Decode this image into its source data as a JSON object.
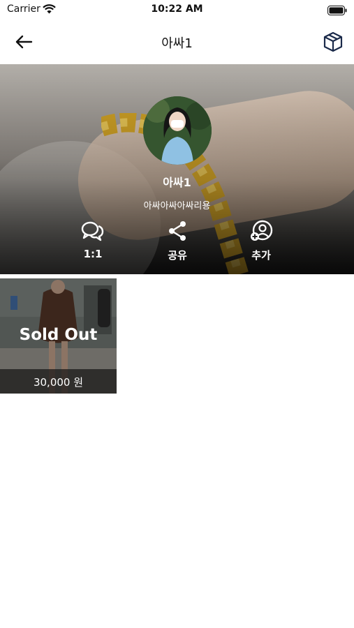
{
  "status_bar": {
    "carrier": "Carrier",
    "time": "10:22 AM"
  },
  "nav": {
    "title": "아싸1",
    "back_icon": "arrow-left-icon",
    "box_icon": "cube-icon"
  },
  "profile": {
    "name": "아싸1",
    "bio": "아싸아싸아싸리용"
  },
  "actions": [
    {
      "label": "1:1",
      "icon": "chat-bubbles-icon"
    },
    {
      "label": "공유",
      "icon": "share-icon"
    },
    {
      "label": "추가",
      "icon": "add-user-icon"
    }
  ],
  "products": [
    {
      "status": "Sold Out",
      "price": "30,000 원"
    }
  ]
}
